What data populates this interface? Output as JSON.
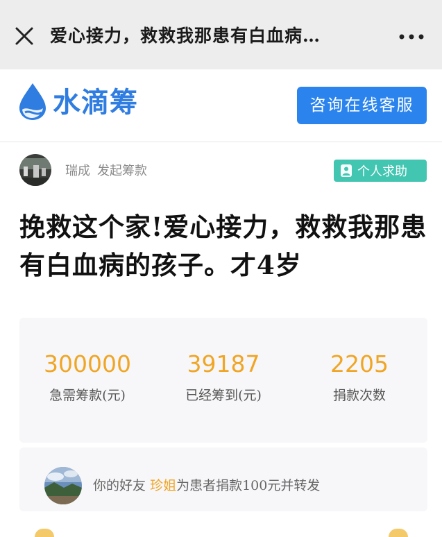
{
  "topbar": {
    "title": "爱心接力，救救我那患有白血病…"
  },
  "brand": {
    "logo_text": "水滴筹",
    "consult_button": "咨询在线客服"
  },
  "initiator": {
    "name": "瑞成",
    "action": "发起筹款",
    "badge": "个人求助"
  },
  "headline": "挽救这个家!爱心接力，救救我那患有白血病的孩子。才4岁",
  "stats": [
    {
      "value": "300000",
      "label": "急需筹款(元)"
    },
    {
      "value": "39187",
      "label": "已经筹到(元)"
    },
    {
      "value": "2205",
      "label": "捐款次数"
    }
  ],
  "friend_notice": {
    "prefix": "你的好友",
    "friend_name": "珍姐",
    "suffix": "为患者捐款100元并转发"
  },
  "colors": {
    "brand_blue": "#2f7de1",
    "button_blue": "#2b84ee",
    "badge_teal": "#42c5b1",
    "stat_orange": "#f0a524"
  },
  "icons": {
    "close": "close-icon",
    "more": "more-dots-icon",
    "logo": "water-drop-logo-icon",
    "badge": "person-icon"
  }
}
